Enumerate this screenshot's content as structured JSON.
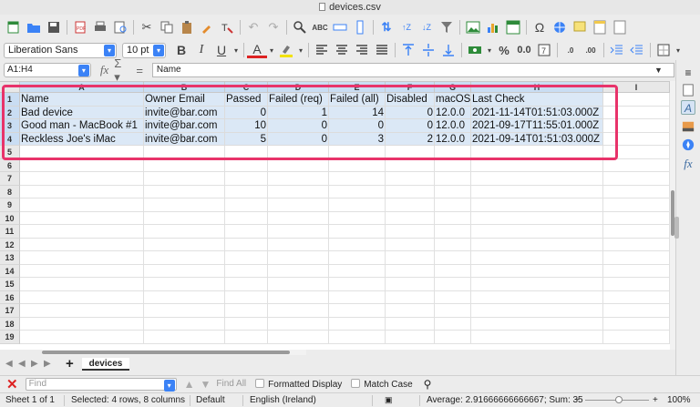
{
  "window": {
    "title": "devices.csv"
  },
  "toolbar": {
    "font_name": "Liberation Sans",
    "font_size": "10 pt"
  },
  "formula": {
    "cell_ref": "A1:H4",
    "content": "Name"
  },
  "sheet": {
    "columns": [
      "A",
      "B",
      "C",
      "D",
      "E",
      "F",
      "G",
      "H",
      "I"
    ],
    "rows": [
      "1",
      "2",
      "3",
      "4",
      "5",
      "6",
      "7",
      "8",
      "9",
      "10",
      "11",
      "12",
      "13",
      "14",
      "15",
      "16",
      "17",
      "18",
      "19"
    ],
    "header_row": [
      "Name",
      "Owner Email",
      "Passed",
      "Failed (req)",
      "Failed (all)",
      "Disabled",
      "macOS",
      "Last Check"
    ],
    "data": [
      [
        "Bad device",
        "invite@bar.com",
        "0",
        "1",
        "14",
        "0",
        "12.0.0",
        "2021-11-14T01:51:03.000Z"
      ],
      [
        "Good man - MacBook #1",
        "invite@bar.com",
        "10",
        "0",
        "0",
        "0",
        "12.0.0",
        "2021-09-17T11:55:01.000Z"
      ],
      [
        "Reckless Joe's iMac",
        "invite@bar.com",
        "5",
        "0",
        "3",
        "2",
        "12.0.0",
        "2021-09-14T01:51:03.000Z"
      ]
    ]
  },
  "tabs": {
    "active_sheet": "devices"
  },
  "find": {
    "placeholder": "Find",
    "find_all": "Find All",
    "formatted_display": "Formatted Display",
    "match_case": "Match Case"
  },
  "status": {
    "sheet": "Sheet 1 of 1",
    "selection": "Selected: 4 rows, 8 columns",
    "style": "Default",
    "language": "English (Ireland)",
    "stats": "Average: 2.91666666666667; Sum: 35",
    "zoom": "100%"
  },
  "colors": {
    "highlight": "#e8336a",
    "selection": "#dbe8f6",
    "accent": "#3b82f6"
  }
}
